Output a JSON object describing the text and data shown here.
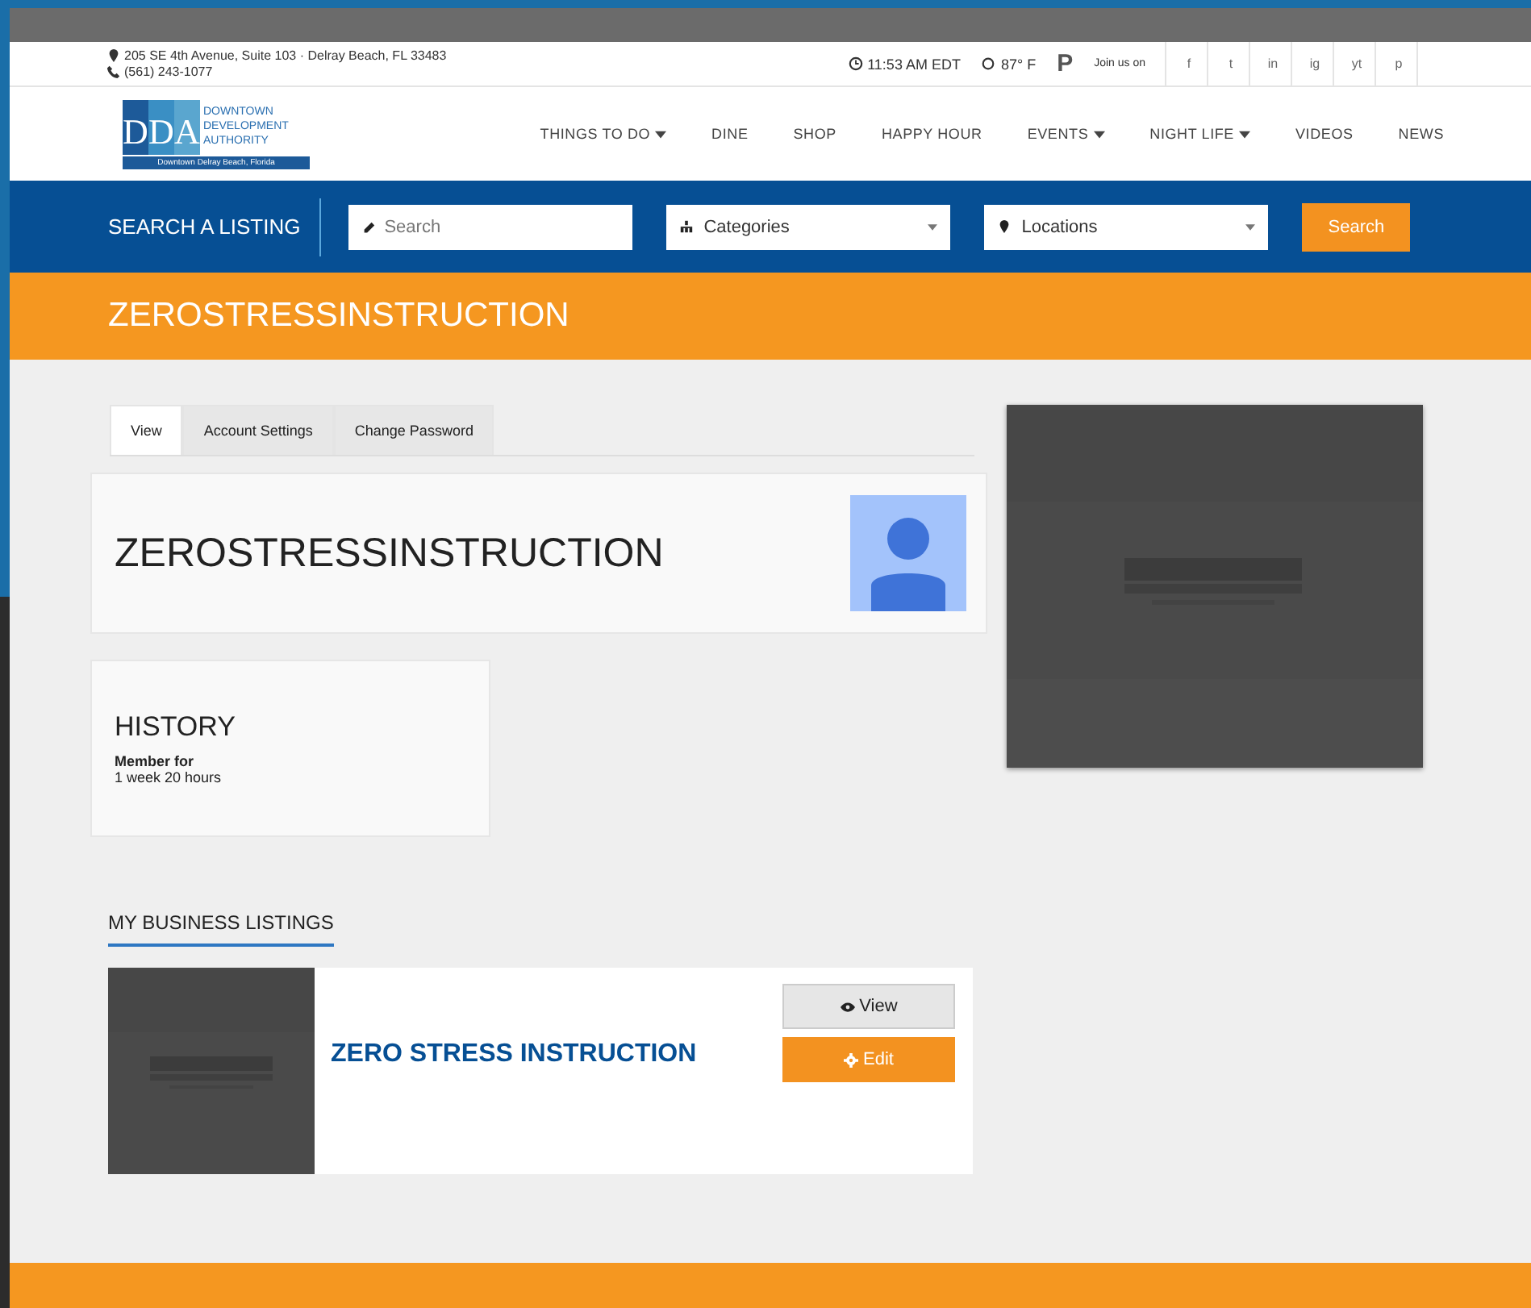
{
  "topbar": {
    "address": "205 SE 4th Avenue, Suite 103 · Delray Beach, FL 33483",
    "phone": "(561) 243-1077",
    "time": "11:53 AM EDT",
    "weather": "87° F",
    "parking": "P",
    "social_label": "Join us on",
    "social": [
      "f",
      "t",
      "in",
      "ig",
      "yt",
      "p"
    ]
  },
  "logo": {
    "letters": [
      "D",
      "D",
      "A"
    ],
    "lines": [
      "DOWNTOWN",
      "DEVELOPMENT",
      "AUTHORITY"
    ],
    "tagline": "Downtown Delray Beach, Florida"
  },
  "nav": [
    {
      "label": "THINGS TO DO",
      "dropdown": true
    },
    {
      "label": "DINE",
      "dropdown": false
    },
    {
      "label": "SHOP",
      "dropdown": false
    },
    {
      "label": "HAPPY HOUR",
      "dropdown": false
    },
    {
      "label": "EVENTS",
      "dropdown": true
    },
    {
      "label": "NIGHT LIFE",
      "dropdown": true
    },
    {
      "label": "VIDEOS",
      "dropdown": false
    },
    {
      "label": "NEWS",
      "dropdown": false
    }
  ],
  "search_bar": {
    "title": "SEARCH A LISTING",
    "search_placeholder": "Search",
    "categories": "Categories",
    "locations": "Locations",
    "button": "Search"
  },
  "page_title": "ZEROSTRESSINSTRUCTION",
  "tabs": [
    {
      "label": "View",
      "selected": true
    },
    {
      "label": "Account Settings",
      "selected": false
    },
    {
      "label": "Change Password",
      "selected": false
    }
  ],
  "profile": {
    "name": "ZEROSTRESSINSTRUCTION"
  },
  "history": {
    "title": "HISTORY",
    "label": "Member for",
    "value": "1 week 20 hours"
  },
  "listings": {
    "title": "MY BUSINESS LISTINGS",
    "items": [
      {
        "name": "ZERO STRESS INSTRUCTION",
        "view": "View",
        "edit": "Edit"
      }
    ]
  }
}
